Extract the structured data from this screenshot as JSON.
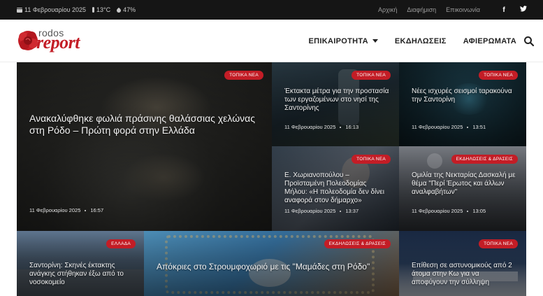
{
  "topbar": {
    "date": "11 Φεβρουαρίου 2025",
    "temperature": "13°C",
    "humidity": "47%",
    "links": [
      "Αρχική",
      "Διαφήμιση",
      "Επικοινωνία"
    ],
    "social": [
      {
        "name": "facebook-icon",
        "glyph": "f"
      },
      {
        "name": "twitter-icon",
        "glyph": "🐦"
      }
    ]
  },
  "logo": {
    "small": "rodos",
    "big": "report"
  },
  "nav": {
    "items": [
      "ΕΠΙΚΑΙΡΟΤΗΤΑ",
      "ΕΚΔΗΛΩΣΕΙΣ",
      "ΑΦΙΕΡΩΜΑΤΑ"
    ]
  },
  "colors": {
    "accent": "#c31d26",
    "topbar": "#151515"
  },
  "articles": [
    {
      "badge": "ΤΟΠΙΚΑ ΝΕΑ",
      "title": "Ανακαλύφθηκε φωλιά πράσινης θαλάσσιας χελώνας στη Ρόδο – Πρώτη φορά στην Ελλάδα",
      "date": "11 Φεβρουαρίου 2025",
      "time": "16:57"
    },
    {
      "badge": "ΤΟΠΙΚΑ ΝΕΑ",
      "title": "Έκτακτα μέτρα για την προστασία των εργαζομένων στο νησί της Σαντορίνης",
      "date": "11 Φεβρουαρίου 2025",
      "time": "16:13"
    },
    {
      "badge": "ΤΟΠΙΚΑ ΝΕΑ",
      "title": "Νέες ισχυρές σεισμοί ταρακούνα την Σαντορίνη",
      "date": "11 Φεβρουαρίου 2025",
      "time": "13:51"
    },
    {
      "badge": "ΤΟΠΙΚΑ ΝΕΑ",
      "title": "Ε. Χωριανοπούλου – Προϊσταμένη Πολεοδομίας Μήλου: «Η πολεοδομία δεν δίνει αναφορά στον δήμαρχο»",
      "date": "11 Φεβρουαρίου 2025",
      "time": "13:37"
    },
    {
      "badge": "ΕΚΔΗΛΩΣΕΙΣ & ΔΡΑΣΕΙΣ",
      "title": "Ομιλία της Νεκταρίας Δασκαλή με θέμα \"Περί Έρωτος και άλλων αναλφαβήτων\"",
      "date": "11 Φεβρουαρίου 2025",
      "time": "13:05"
    },
    {
      "badge": "ΕΛΛΑΔΑ",
      "title": "Σαντορίνη: Σκηνές έκτακτης ανάγκης στήθηκαν έξω από το νοσοκομείο",
      "date": "",
      "time": ""
    },
    {
      "badge": "ΕΚΔΗΛΩΣΕΙΣ & ΔΡΑΣΕΙΣ",
      "title": "Απόκριες στο Στρουμφοχωριό με τις \"Μαμάδες στη Ρόδο\"",
      "date": "",
      "time": ""
    },
    {
      "badge": "ΤΟΠΙΚΑ ΝΕΑ",
      "title": "Επίθεση σε αστυνομικούς από 2 άτομα στην Κω για να αποφύγουν την σύλληψη",
      "date": "",
      "time": ""
    }
  ]
}
